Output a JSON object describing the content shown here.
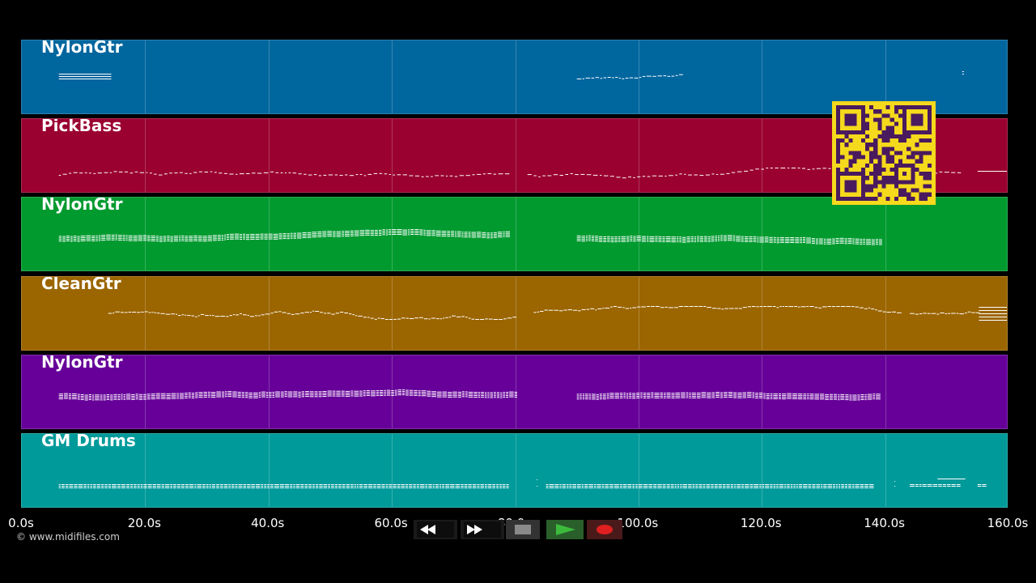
{
  "colors": {
    "background": "#000000",
    "note": "#ffffff"
  },
  "tracks": [
    {
      "name": "NylonGtr",
      "color": "#00669e",
      "note_color": "#ffffff"
    },
    {
      "name": "PickBass",
      "color": "#9a0030",
      "note_color": "#ffffff"
    },
    {
      "name": "NylonGtr",
      "color": "#009a2f",
      "note_color": "#ffffff"
    },
    {
      "name": "CleanGtr",
      "color": "#9b6500",
      "note_color": "#ffffff"
    },
    {
      "name": "NylonGtr",
      "color": "#660099",
      "note_color": "#ffffff"
    },
    {
      "name": "GM Drums",
      "color": "#009a9a",
      "note_color": "#ffffff"
    }
  ],
  "timeline": {
    "duration_seconds": 160,
    "ticks": [
      "0.0s",
      "20.0s",
      "40.0s",
      "60.0s",
      "80.0s",
      "100.0s",
      "120.0s",
      "140.0s",
      "160.0s"
    ]
  },
  "transport": {
    "rewind_icon": "rewind-icon",
    "fast_forward_icon": "fast-forward-icon",
    "stop_icon": "stop-icon",
    "play_icon": "play-icon",
    "record_icon": "record-icon",
    "play_color": "#3cba3c",
    "record_color": "#e02020"
  },
  "qr_code": {
    "icon": "qr-code-icon",
    "fg": "#4a1a5e",
    "bg": "#f5d91c"
  },
  "copyright": "© www.midifiles.com"
}
